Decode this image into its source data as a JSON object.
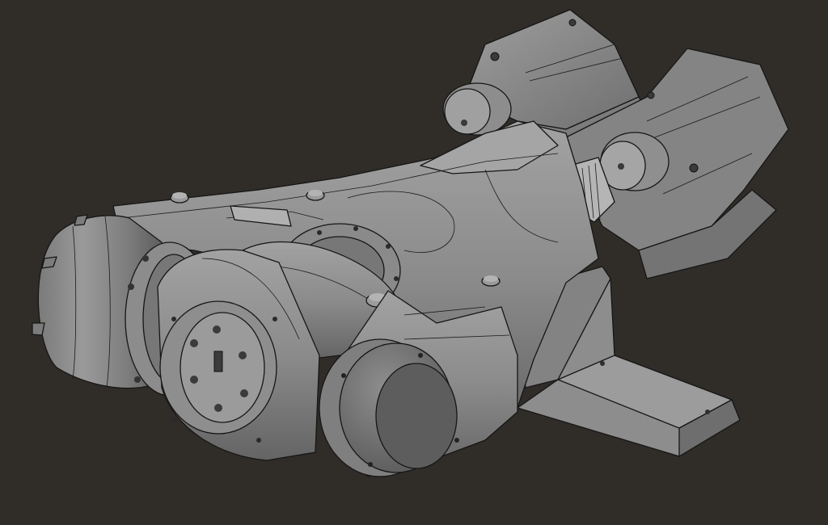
{
  "viewport": {
    "background": "#302d29",
    "render_style": "shaded-with-edges"
  },
  "model": {
    "base_color": "#8a8a8a",
    "shadow_color": "#5e5e5e",
    "highlight_color": "#a7a7a7",
    "edge_color": "#161616"
  }
}
